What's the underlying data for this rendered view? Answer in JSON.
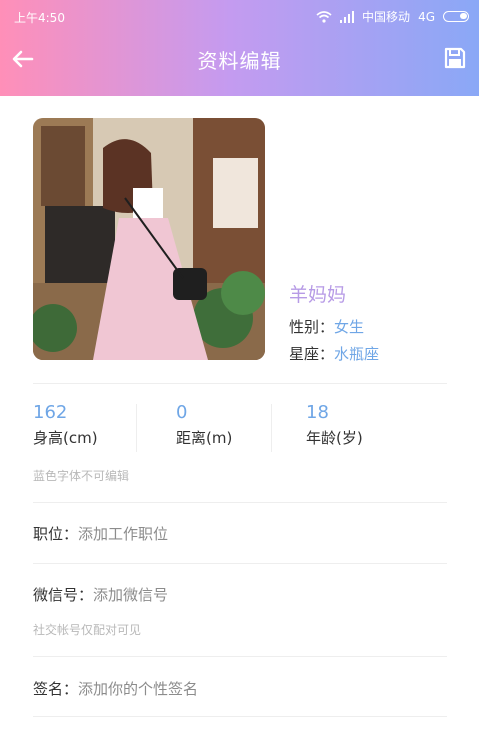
{
  "status": {
    "time": "上午4:50",
    "carrier": "中国移动",
    "network": "4G"
  },
  "header": {
    "title": "资料编辑"
  },
  "profile": {
    "nickname": "羊妈妈",
    "gender_label": "性别：",
    "gender": "女生",
    "zodiac_label": "星座：",
    "zodiac": "水瓶座"
  },
  "stats": [
    {
      "value": "162",
      "label": "身高(cm)"
    },
    {
      "value": "0",
      "label": "距离(m)"
    },
    {
      "value": "18",
      "label": "年龄(岁)"
    }
  ],
  "hints": {
    "blue_readonly": "蓝色字体不可编辑",
    "social_visibility": "社交帐号仅配对可见"
  },
  "fields": {
    "position": {
      "label": "职位：",
      "placeholder": "添加工作职位"
    },
    "wechat": {
      "label": "微信号：",
      "placeholder": "添加微信号"
    },
    "signature": {
      "label": "签名：",
      "placeholder": "添加你的个性签名"
    }
  },
  "colors": {
    "accent_blue": "#6fa6e6",
    "nickname_purple": "#b79be6"
  },
  "icons": {
    "back": "arrow-left-icon",
    "save": "floppy-disk-icon"
  }
}
